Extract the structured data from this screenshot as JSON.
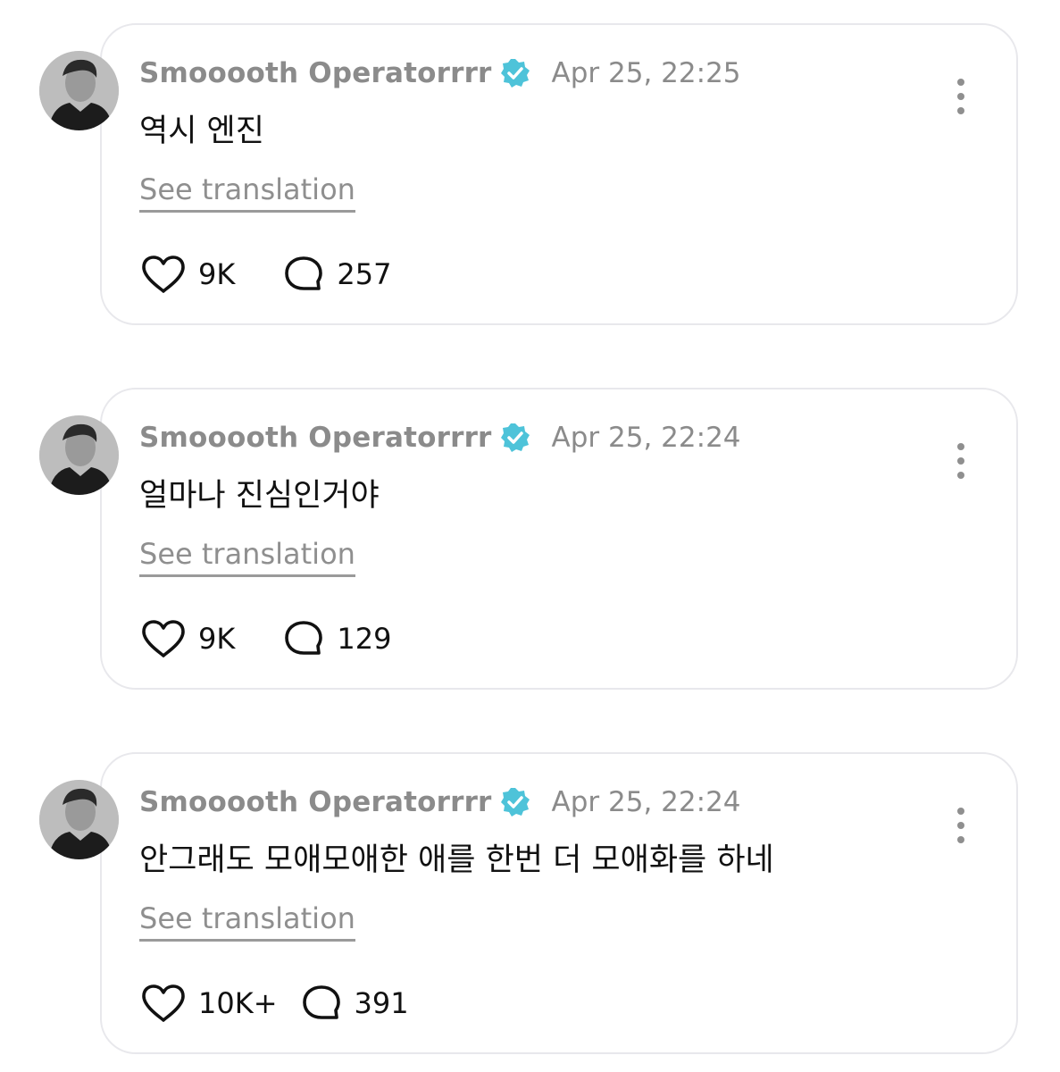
{
  "colors": {
    "verified_badge": "#4ec3d9",
    "secondary_text": "#8b8b8b",
    "card_border": "#e8e8ec"
  },
  "posts": [
    {
      "username": "Smooooth Operatorrrr",
      "timestamp": "Apr 25, 22:25",
      "text": "역시 엔진",
      "see_translation": "See translation",
      "likes": "9K",
      "replies": "257"
    },
    {
      "username": "Smooooth Operatorrrr",
      "timestamp": "Apr 25, 22:24",
      "text": "얼마나 진심인거야",
      "see_translation": "See translation",
      "likes": "9K",
      "replies": "129"
    },
    {
      "username": "Smooooth Operatorrrr",
      "timestamp": "Apr 25, 22:24",
      "text": "안그래도 모애모애한 애를 한번 더 모애화를 하네",
      "see_translation": "See translation",
      "likes": "10K+",
      "replies": "391"
    }
  ]
}
